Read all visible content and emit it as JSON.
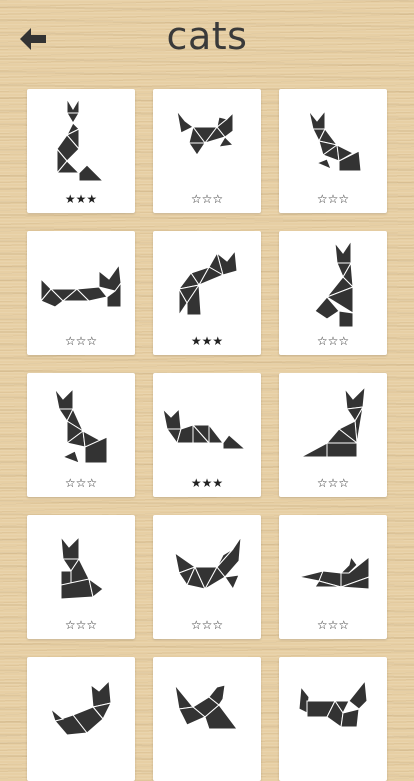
{
  "header": {
    "title": "cats",
    "back_icon": "back-arrow-icon"
  },
  "levels": [
    {
      "name": "cat-sitting-tall",
      "stars": "★★★"
    },
    {
      "name": "cat-pouncing",
      "stars": "☆☆☆"
    },
    {
      "name": "cat-sitting-side",
      "stars": "☆☆☆"
    },
    {
      "name": "cat-lying",
      "stars": "☆☆☆"
    },
    {
      "name": "cat-arched",
      "stars": "★★★"
    },
    {
      "name": "cat-upright-tall",
      "stars": "☆☆☆"
    },
    {
      "name": "cat-sitting-small",
      "stars": "☆☆☆"
    },
    {
      "name": "cat-crouching",
      "stars": "★★★"
    },
    {
      "name": "cat-tall-tail",
      "stars": "☆☆☆"
    },
    {
      "name": "cat-sitting-front",
      "stars": "☆☆☆"
    },
    {
      "name": "cat-walking",
      "stars": "☆☆☆"
    },
    {
      "name": "cat-sleeping-flat",
      "stars": "☆☆☆"
    },
    {
      "name": "cat-stretching",
      "stars": ""
    },
    {
      "name": "cat-playing",
      "stars": ""
    },
    {
      "name": "cat-standing",
      "stars": ""
    }
  ],
  "colors": {
    "background": "#e7cfa4",
    "card": "#ffffff",
    "shape": "#333333",
    "title": "#3a3a3a"
  }
}
